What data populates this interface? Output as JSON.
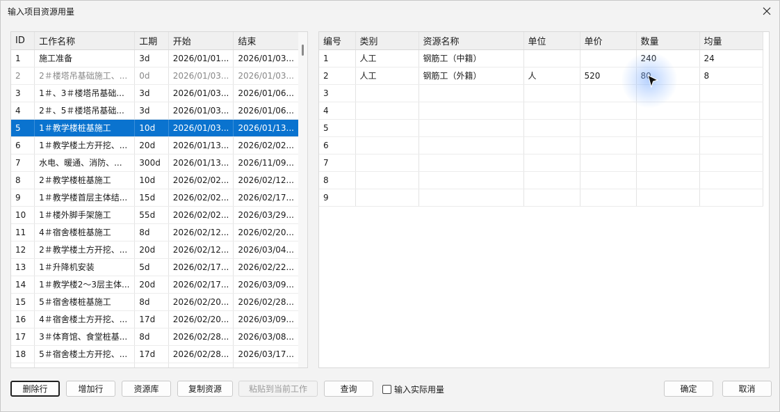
{
  "window": {
    "title": "输入项目资源用量"
  },
  "left_table": {
    "columns": [
      "ID",
      "工作名称",
      "工期",
      "开始",
      "结束"
    ],
    "rows": [
      [
        "1",
        "施工准备",
        "3d",
        "2026/01/01...",
        "2026/01/03..."
      ],
      [
        "2",
        "2＃楼塔吊基础施工、...",
        "0d",
        "2026/01/03...",
        "2026/01/03..."
      ],
      [
        "3",
        "1＃、3＃楼塔吊基础...",
        "3d",
        "2026/01/03...",
        "2026/01/06..."
      ],
      [
        "4",
        "2＃、5＃楼塔吊基础...",
        "3d",
        "2026/01/03...",
        "2026/01/06..."
      ],
      [
        "5",
        "1＃教学楼桩基施工",
        "10d",
        "2026/01/03...",
        "2026/01/13..."
      ],
      [
        "6",
        "1＃教学楼土方开挖、...",
        "20d",
        "2026/01/13...",
        "2026/02/02..."
      ],
      [
        "7",
        "水电、暖通、消防、...",
        "300d",
        "2026/01/13...",
        "2026/11/09..."
      ],
      [
        "8",
        "2＃教学楼桩基施工",
        "10d",
        "2026/02/02...",
        "2026/02/12..."
      ],
      [
        "9",
        "1＃教学楼首层主体结...",
        "15d",
        "2026/02/02...",
        "2026/02/17..."
      ],
      [
        "10",
        "1＃楼外脚手架施工",
        "55d",
        "2026/02/02...",
        "2026/03/29..."
      ],
      [
        "11",
        "4＃宿舍楼桩基施工",
        "8d",
        "2026/02/12...",
        "2026/02/20..."
      ],
      [
        "12",
        "2＃教学楼土方开挖、...",
        "20d",
        "2026/02/12...",
        "2026/03/04..."
      ],
      [
        "13",
        "1＃升降机安装",
        "5d",
        "2026/02/17...",
        "2026/02/22..."
      ],
      [
        "14",
        "1＃教学楼2～3层主体...",
        "20d",
        "2026/02/17...",
        "2026/03/09..."
      ],
      [
        "15",
        "5＃宿舍楼桩基施工",
        "8d",
        "2026/02/20...",
        "2026/02/28..."
      ],
      [
        "16",
        "4＃宿舍楼土方开挖、...",
        "17d",
        "2026/02/20...",
        "2026/03/09..."
      ],
      [
        "17",
        "3＃体育馆、食堂桩基...",
        "8d",
        "2026/02/28...",
        "2026/03/08..."
      ],
      [
        "18",
        "5＃宿舍楼土方开挖、...",
        "17d",
        "2026/02/28...",
        "2026/03/17..."
      ]
    ],
    "selected_row_index": 4,
    "disabled_row_index": 1
  },
  "right_table": {
    "columns": [
      "编号",
      "类别",
      "资源名称",
      "单位",
      "单价",
      "数量",
      "均量"
    ],
    "rows": [
      [
        "1",
        "人工",
        "钢筋工（中籍）",
        "",
        "",
        "240",
        "24"
      ],
      [
        "2",
        "人工",
        "钢筋工（外籍）",
        "人",
        "520",
        "80",
        "8"
      ],
      [
        "3",
        "",
        "",
        "",
        "",
        "",
        ""
      ],
      [
        "4",
        "",
        "",
        "",
        "",
        "",
        ""
      ],
      [
        "5",
        "",
        "",
        "",
        "",
        "",
        ""
      ],
      [
        "6",
        "",
        "",
        "",
        "",
        "",
        ""
      ],
      [
        "7",
        "",
        "",
        "",
        "",
        "",
        ""
      ],
      [
        "8",
        "",
        "",
        "",
        "",
        "",
        ""
      ],
      [
        "9",
        "",
        "",
        "",
        "",
        "",
        ""
      ]
    ]
  },
  "buttons": {
    "delete_row": "删除行",
    "add_row": "增加行",
    "resource_lib": "资源库",
    "copy_resource": "复制资源",
    "paste_to_current": "粘贴到当前工作",
    "query": "查询",
    "input_actual": "输入实际用量",
    "ok": "确定",
    "cancel": "取消"
  },
  "colors": {
    "selection": "#0a73cf",
    "window_bg": "#f3f3f3"
  }
}
